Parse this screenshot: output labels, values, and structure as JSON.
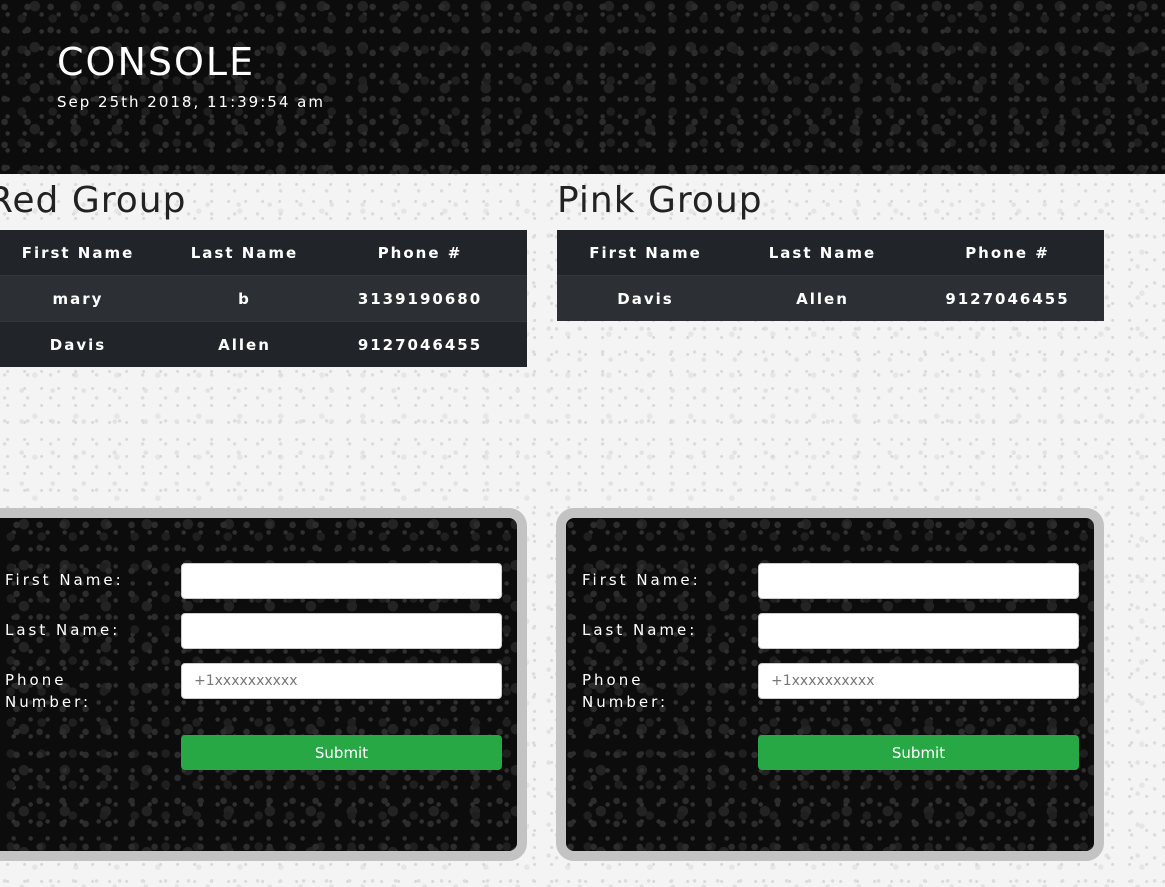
{
  "header": {
    "title": "CONSOLE",
    "timestamp": "Sep 25th 2018, 11:39:54 am"
  },
  "groups": [
    {
      "name": "Red Group",
      "columns": [
        "First Name",
        "Last Name",
        "Phone #"
      ],
      "rows": [
        [
          "mary",
          "b",
          "3139190680"
        ],
        [
          "Davis",
          "Allen",
          "9127046455"
        ]
      ]
    },
    {
      "name": "Pink Group",
      "columns": [
        "First Name",
        "Last Name",
        "Phone #"
      ],
      "rows": [
        [
          "Davis",
          "Allen",
          "9127046455"
        ]
      ]
    }
  ],
  "form": {
    "first_name_label": "First Name:",
    "last_name_label": "Last Name:",
    "phone_label_line1": "Phone",
    "phone_label_line2": "Number:",
    "phone_placeholder": "+1xxxxxxxxxx",
    "submit_label": "Submit"
  },
  "colors": {
    "submit": "#28a745",
    "table_dark": "#212529",
    "card_border": "#c3c3c3"
  }
}
